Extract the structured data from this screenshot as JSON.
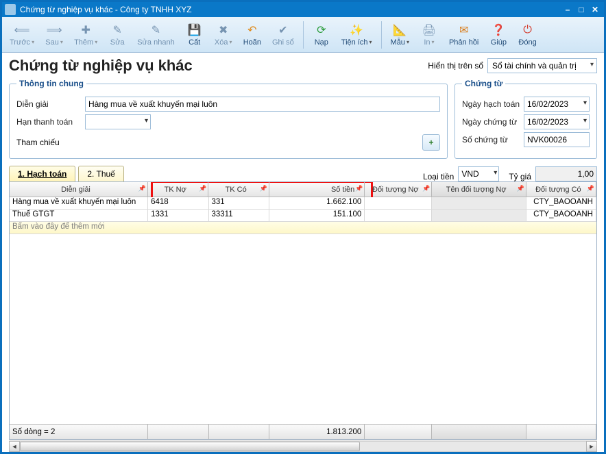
{
  "window": {
    "title": "Chứng từ nghiệp vụ khác - Công ty TNHH XYZ"
  },
  "toolbar": {
    "prev": "Trước",
    "next": "Sau",
    "add": "Thêm",
    "edit": "Sửa",
    "quickedit": "Sửa nhanh",
    "cut": "Cất",
    "delete": "Xóa",
    "undo": "Hoãn",
    "post": "Ghi sổ",
    "load": "Nạp",
    "util": "Tiện ích",
    "template": "Mẫu",
    "print": "In",
    "feedback": "Phản hồi",
    "help": "Giúp",
    "close": "Đóng"
  },
  "page": {
    "title": "Chứng từ nghiệp vụ khác",
    "show_on_label": "Hiển thị trên sổ",
    "show_on_value": "Sổ tài chính và quản trị"
  },
  "general": {
    "legend": "Thông tin chung",
    "desc_label": "Diễn giải",
    "desc_value": "Hàng mua về xuất khuyến mại luôn",
    "duedate_label": "Hạn thanh toán",
    "duedate_value": "",
    "ref_label": "Tham chiếu",
    "addref_glyph": "+"
  },
  "voucher": {
    "legend": "Chứng từ",
    "postdate_label": "Ngày hạch toán",
    "postdate_value": "16/02/2023",
    "vdate_label": "Ngày chứng từ",
    "vdate_value": "16/02/2023",
    "vno_label": "Số chứng từ",
    "vno_value": "NVK00026"
  },
  "tabs": {
    "tab1": "1. Hạch toán",
    "tab2": "2. Thuế"
  },
  "currency": {
    "label": "Loại tiền",
    "value": "VND",
    "rate_label": "Tỷ giá",
    "rate_value": "1,00"
  },
  "grid": {
    "headers": {
      "desc": "Diễn giải",
      "tkno": "TK Nợ",
      "tkco": "TK Có",
      "amount": "Số tiền",
      "dtno": "Đối tượng Nợ",
      "tendtno": "Tên đối tượng Nợ",
      "dtco": "Đối tượng Có"
    },
    "rows": [
      {
        "desc": "Hàng mua về xuất khuyến mại luôn",
        "tkno": "6418",
        "tkco": "331",
        "amount": "1.662.100",
        "dtco": "CTY_BAOOANH"
      },
      {
        "desc": "Thuế GTGT",
        "tkno": "1331",
        "tkco": "33311",
        "amount": "151.100",
        "dtco": "CTY_BAOOANH"
      }
    ],
    "newrow_hint": "Bấm vào đây để thêm mới",
    "footer": {
      "rowcount_label": "Số dòng = 2",
      "sum_amount": "1.813.200"
    }
  }
}
